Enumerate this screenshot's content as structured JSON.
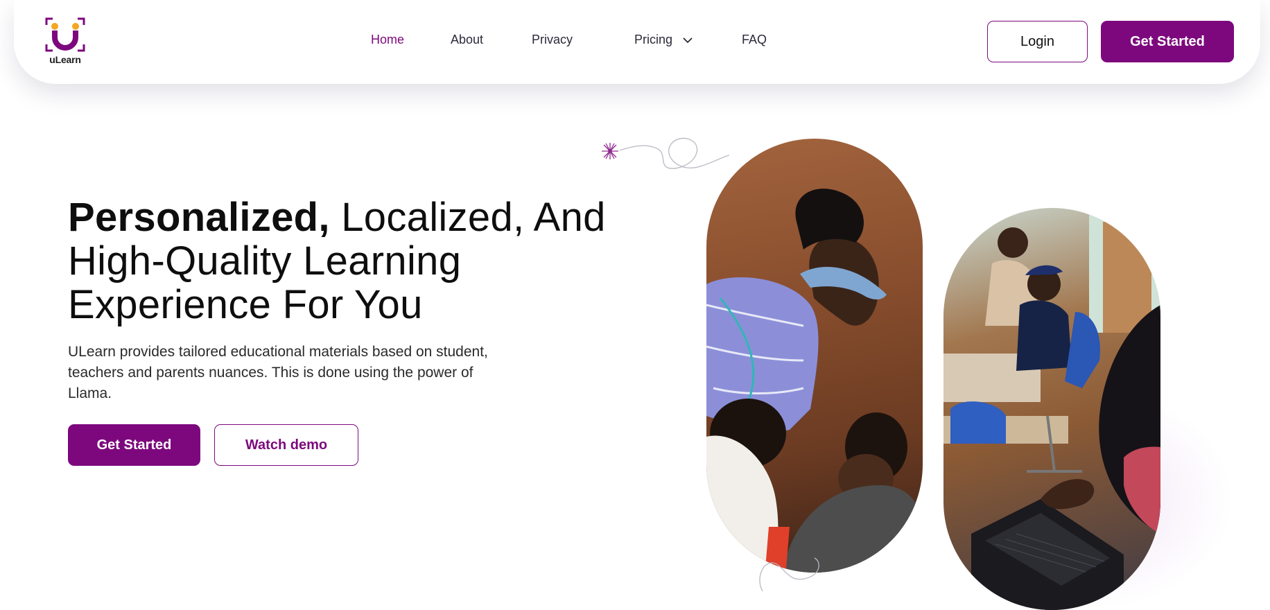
{
  "brand": {
    "name": "uLearn",
    "primary_color": "#7d087d",
    "accent_color": "#f5a623"
  },
  "nav": {
    "links": [
      {
        "label": "Home",
        "active": true
      },
      {
        "label": "About",
        "active": false
      },
      {
        "label": "Privacy",
        "active": false
      },
      {
        "label": "Pricing",
        "active": false,
        "dropdown": true
      },
      {
        "label": "FAQ",
        "active": false
      }
    ],
    "login_label": "Login",
    "get_started_label": "Get Started"
  },
  "hero": {
    "title_bold": "Personalized,",
    "title_rest_line1": " Localized, And",
    "title_line2": "High-Quality Learning",
    "title_line3": "Experience For You",
    "subtitle": "ULearn provides tailored educational materials based on student, teachers and parents nuances. This is done using the power of Llama.",
    "primary_button": "Get Started",
    "secondary_button": "Watch demo"
  },
  "images": [
    {
      "icon": "photo-teacher-helping-students"
    },
    {
      "icon": "photo-students-at-laptops"
    }
  ]
}
